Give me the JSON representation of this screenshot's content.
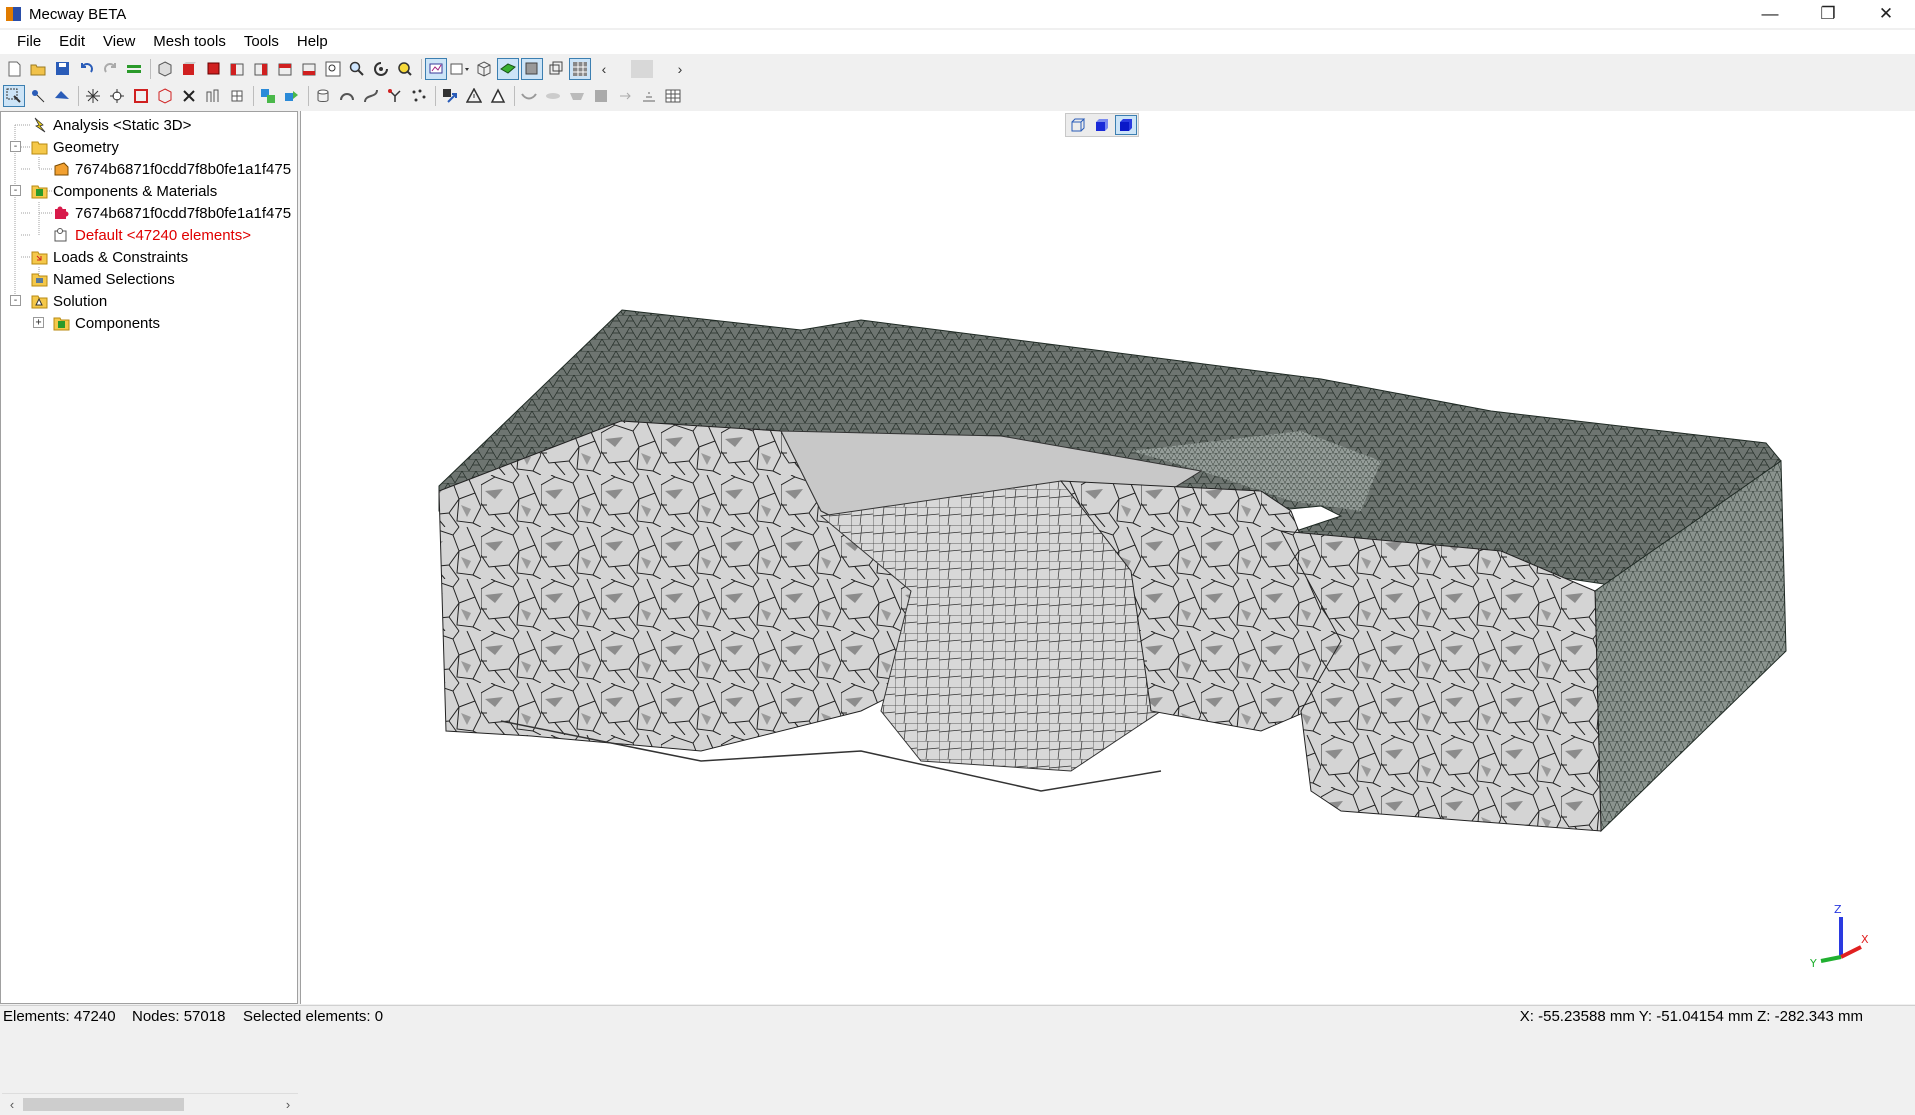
{
  "window": {
    "title": "Mecway BETA"
  },
  "menu": [
    "File",
    "Edit",
    "View",
    "Mesh tools",
    "Tools",
    "Help"
  ],
  "tree": {
    "analysis": "Analysis <Static 3D>",
    "geometry": "Geometry",
    "geometry_item": "7674b6871f0cdd7f8b0fe1a1f475",
    "components_materials": "Components & Materials",
    "component_item": "7674b6871f0cdd7f8b0fe1a1f475",
    "default_item": "Default <47240 elements>",
    "loads_constraints": "Loads & Constraints",
    "named_selections": "Named Selections",
    "solution": "Solution",
    "solution_components": "Components"
  },
  "status": {
    "elements": "Elements: 47240",
    "nodes": "Nodes: 57018",
    "selected": "Selected elements: 0",
    "coords": "X: -55.23588 mm Y: -51.04154 mm Z: -282.343 mm"
  },
  "axes": {
    "z": "Z",
    "x": "X",
    "y": "Y"
  },
  "colors": {
    "mesh_light": "#d2d2d2",
    "mesh_dark": "#6e7571",
    "mesh_lines": "#1f2a24",
    "error_text": "#e00000"
  }
}
